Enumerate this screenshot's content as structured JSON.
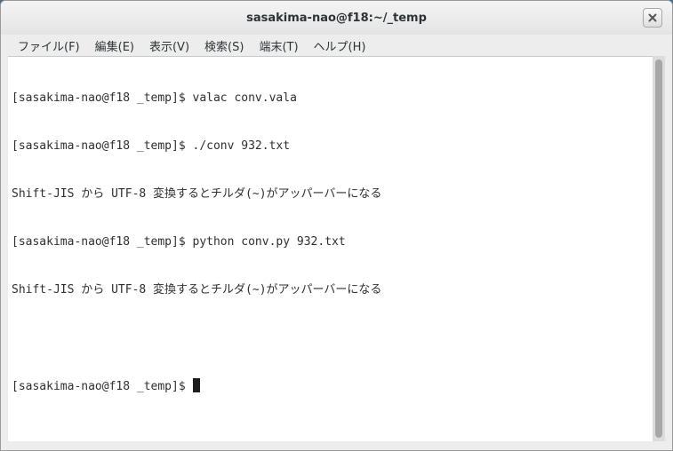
{
  "window": {
    "title": "sasakima-nao@f18:~/_temp"
  },
  "menubar": {
    "items": [
      {
        "label": "ファイル(F)"
      },
      {
        "label": "編集(E)"
      },
      {
        "label": "表示(V)"
      },
      {
        "label": "検索(S)"
      },
      {
        "label": "端末(T)"
      },
      {
        "label": "ヘルプ(H)"
      }
    ]
  },
  "terminal": {
    "lines": [
      "[sasakima-nao@f18 _temp]$ valac conv.vala",
      "[sasakima-nao@f18 _temp]$ ./conv 932.txt",
      "Shift-JIS から UTF-8 変換するとチルダ(~)がアッパーバーになる",
      "[sasakima-nao@f18 _temp]$ python conv.py 932.txt",
      "Shift-JIS から UTF-8 変換するとチルダ(~)がアッパーバーになる",
      "",
      "[sasakima-nao@f18 _temp]$ "
    ]
  },
  "icons": {
    "close": "close-icon"
  }
}
